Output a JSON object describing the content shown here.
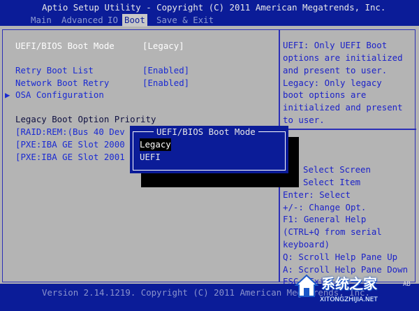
{
  "title": "Aptio Setup Utility - Copyright (C) 2011 American Megatrends, Inc.",
  "menu": [
    "Main",
    "Advanced",
    "IO",
    "Boot",
    "Save & Exit"
  ],
  "active_menu": "Boot",
  "settings": {
    "boot_mode_label": "UEFI/BIOS Boot Mode",
    "boot_mode_value": "[Legacy]",
    "retry_label": "Retry Boot List",
    "retry_value": "[Enabled]",
    "network_label": "Network Boot Retry",
    "network_value": "[Enabled]",
    "osa_label": "OSA Configuration",
    "legacy_priority_label": "Legacy Boot Option Priority",
    "boot_options": [
      "[RAID:REM:(Bus 40 Dev",
      "[PXE:IBA GE Slot 2000",
      "[PXE:IBA GE Slot 2001"
    ]
  },
  "help_text": [
    "UEFI: Only UEFI Boot",
    "options are initialized",
    "and present to user.",
    "Legacy: Only legacy",
    "boot options are",
    "initialized and present",
    "to user."
  ],
  "key_help": [
    "Select Screen",
    "Select Item",
    "Enter: Select",
    "+/-: Change Opt.",
    "F1: General Help",
    "(CTRL+Q from serial",
    "keyboard)",
    "Q: Scroll Help Pane Up",
    "A: Scroll Help Pane Down",
    "ESC: Exit"
  ],
  "popup": {
    "title": "UEFI/BIOS Boot Mode",
    "options": [
      "Legacy",
      "UEFI"
    ],
    "selected": "Legacy"
  },
  "footer": "Version 2.14.1219. Copyright (C) 2011 American Megatrends, Inc.",
  "corner_badge": "AB",
  "watermark": {
    "text": "系统之家",
    "url": "XITONGZHIJIA.NET"
  },
  "colors": {
    "bar_blue": "#0b1c98",
    "panel_grey": "#b4b4b4",
    "accent_blue": "#1a2ad2",
    "popup_blue": "#0b1c98"
  }
}
